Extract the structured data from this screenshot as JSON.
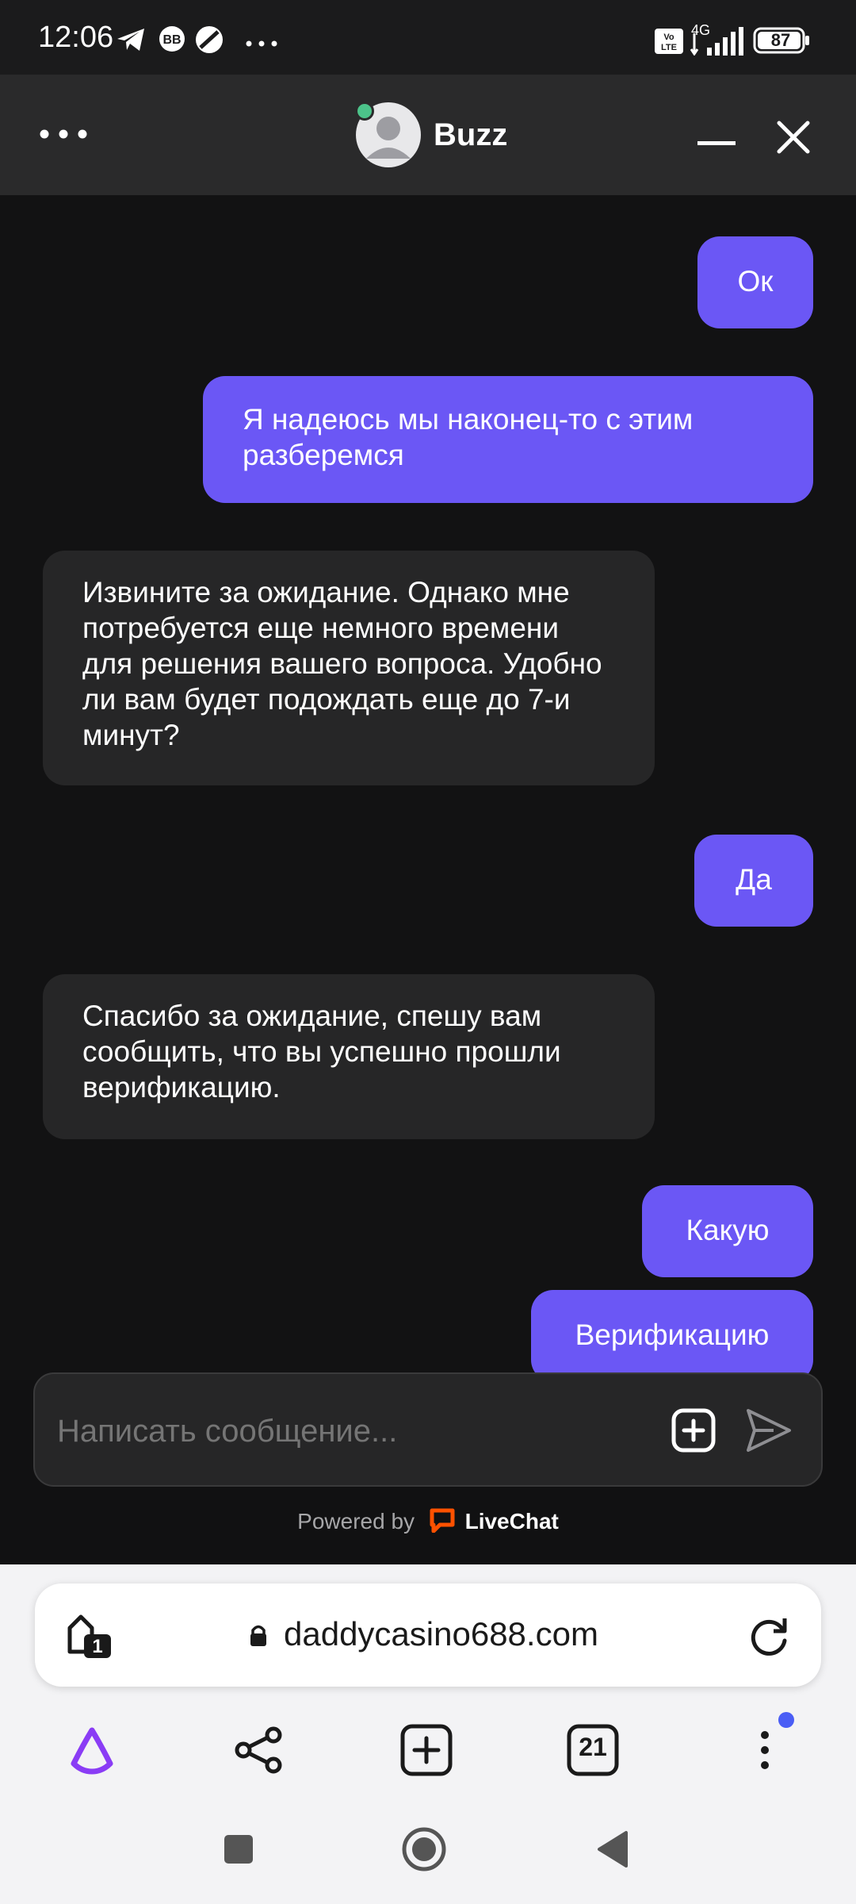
{
  "status_bar": {
    "time": "12:06",
    "network": "4G",
    "volte": "Vo LTE",
    "battery": "87",
    "icons": [
      "telegram-icon",
      "bb-icon",
      "app-icon",
      "more-dots-icon",
      "volte-icon",
      "signal-icon",
      "battery-icon"
    ]
  },
  "chat_header": {
    "agent_name": "Buzz",
    "online_color": "#4cc38a"
  },
  "messages": [
    {
      "from": "user",
      "text": "Ок"
    },
    {
      "from": "user",
      "text": "Я надеюсь мы наконец-то с этим разберемся"
    },
    {
      "from": "agent",
      "text": "Извините за ожидание. Однако мне потребуется еще немного времени для решения вашего вопроса. Удобно ли вам будет подождать еще до 7-и минут?"
    },
    {
      "from": "user",
      "text": "Да"
    },
    {
      "from": "agent",
      "text": "Спасибо за ожидание, спешу вам сообщить, что вы успешно прошли верификацию."
    },
    {
      "from": "user",
      "text": "Какую"
    },
    {
      "from": "user",
      "text": "Верификацию"
    }
  ],
  "composer": {
    "placeholder": "Написать сообщение..."
  },
  "powered_by": {
    "prefix": "Powered by",
    "brand": "LiveChat",
    "brand_color": "#ff5100"
  },
  "browser": {
    "url": "daddycasino688.com",
    "tab_badge": "1",
    "tabs_count": "21"
  },
  "colors": {
    "accent": "#6b57f5",
    "chat_bg": "#121213",
    "agent_bubble": "#262627",
    "alice_purple": "#8a3cf5",
    "notify_dot": "#4a5df5"
  }
}
